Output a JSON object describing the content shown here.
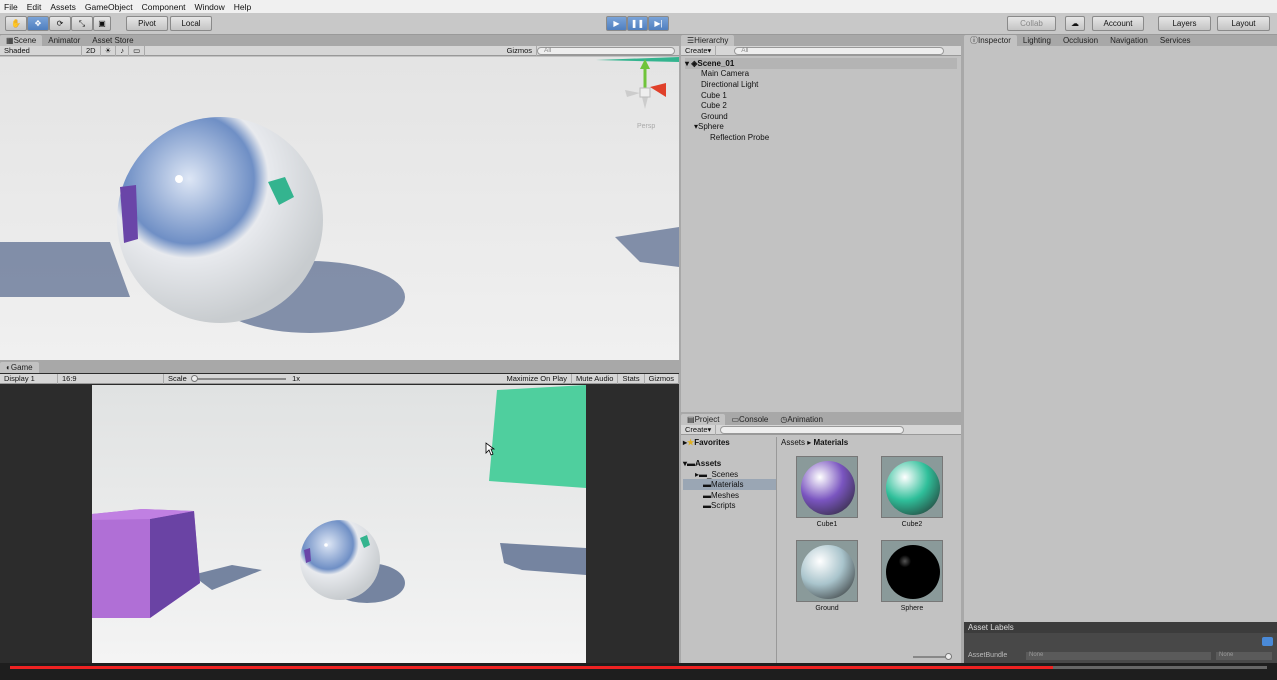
{
  "menu": [
    "File",
    "Edit",
    "Assets",
    "GameObject",
    "Component",
    "Window",
    "Help"
  ],
  "toolbar": {
    "pivot": "Pivot",
    "local": "Local",
    "collab": "Collab",
    "account": "Account",
    "layers": "Layers",
    "layout": "Layout"
  },
  "scene": {
    "tabs": [
      "Scene",
      "Animator",
      "Asset Store"
    ],
    "shaded": "Shaded",
    "mode2d": "2D",
    "gizmos": "Gizmos",
    "search": "All",
    "persp": "Persp"
  },
  "game": {
    "tab": "Game",
    "display": "Display 1",
    "aspect": "16:9",
    "scale_label": "Scale",
    "scale_value": "1x",
    "maximize": "Maximize On Play",
    "mute": "Mute Audio",
    "stats": "Stats",
    "gizmos": "Gizmos"
  },
  "hierarchy": {
    "tab": "Hierarchy",
    "create": "Create",
    "search": "All",
    "scene": "Scene_01",
    "items": [
      "Main Camera",
      "Directional Light",
      "Cube 1",
      "Cube 2",
      "Ground",
      "Sphere",
      "Reflection Probe"
    ]
  },
  "inspector": {
    "tabs": [
      "Inspector",
      "Lighting",
      "Occlusion",
      "Navigation",
      "Services"
    ],
    "asset_labels": "Asset Labels",
    "asset_bundle": "AssetBundle",
    "none1": "None",
    "none2": "None"
  },
  "project": {
    "tabs": [
      "Project",
      "Console",
      "Animation"
    ],
    "create": "Create",
    "favorites": "Favorites",
    "assets": "Assets",
    "folders": [
      "_Scenes",
      "Materials",
      "Meshes",
      "Scripts"
    ],
    "breadcrumb_root": "Assets",
    "breadcrumb_current": "Materials",
    "materials": [
      {
        "name": "Cube1",
        "color": "#7a55c0"
      },
      {
        "name": "Cube2",
        "color": "#2fbf9a"
      },
      {
        "name": "Ground",
        "color": "#a9c4cc"
      },
      {
        "name": "Sphere",
        "color": "#000000"
      }
    ]
  }
}
